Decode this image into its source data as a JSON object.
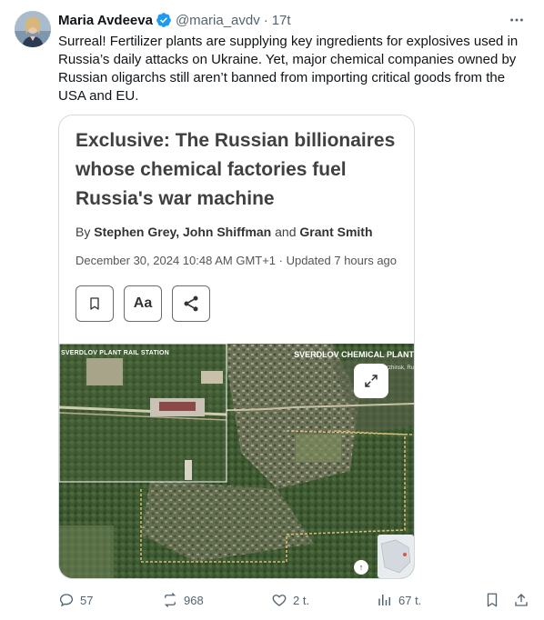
{
  "author": {
    "name": "Maria Avdeeva",
    "handle": "@maria_avdv",
    "separator": "·",
    "time": "17t"
  },
  "tweet": {
    "text": "Surreal! Fertilizer plants are supplying key ingredients for explosives used in Russia’s daily attacks on Ukraine. Yet, major chemical companies owned by Russian oligarchs still aren’t banned from importing critical goods from the USA and EU."
  },
  "article": {
    "title": "Exclusive: The Russian billionaires whose chemical factories fuel Russia's war machine",
    "by": "By",
    "author1": "Stephen Grey",
    "sep1": ",",
    "author2": "John Shiffman",
    "and": "and",
    "author3": "Grant Smith",
    "date": "December 30, 2024 10:48 AM GMT+1 · Updated 7 hours ago",
    "font_button_label": "Aa"
  },
  "satellite": {
    "label_left": "SVERDLOV PLANT RAIL STATION",
    "label_right": "SVERDLOV CHEMICAL PLANT",
    "sub_label": "Dzerzhinsk, Ru"
  },
  "actions": {
    "replies": "57",
    "reposts": "968",
    "likes": "2 t.",
    "views": "67 t."
  },
  "colors": {
    "verified": "#1d9bf0",
    "muted": "#536471"
  },
  "icons": [
    "verified-badge-icon",
    "more-icon",
    "bookmark-icon",
    "font-size-icon",
    "share-icon",
    "expand-icon",
    "reply-icon",
    "repost-icon",
    "like-icon",
    "views-icon",
    "bookmark-icon",
    "share-upload-icon"
  ]
}
